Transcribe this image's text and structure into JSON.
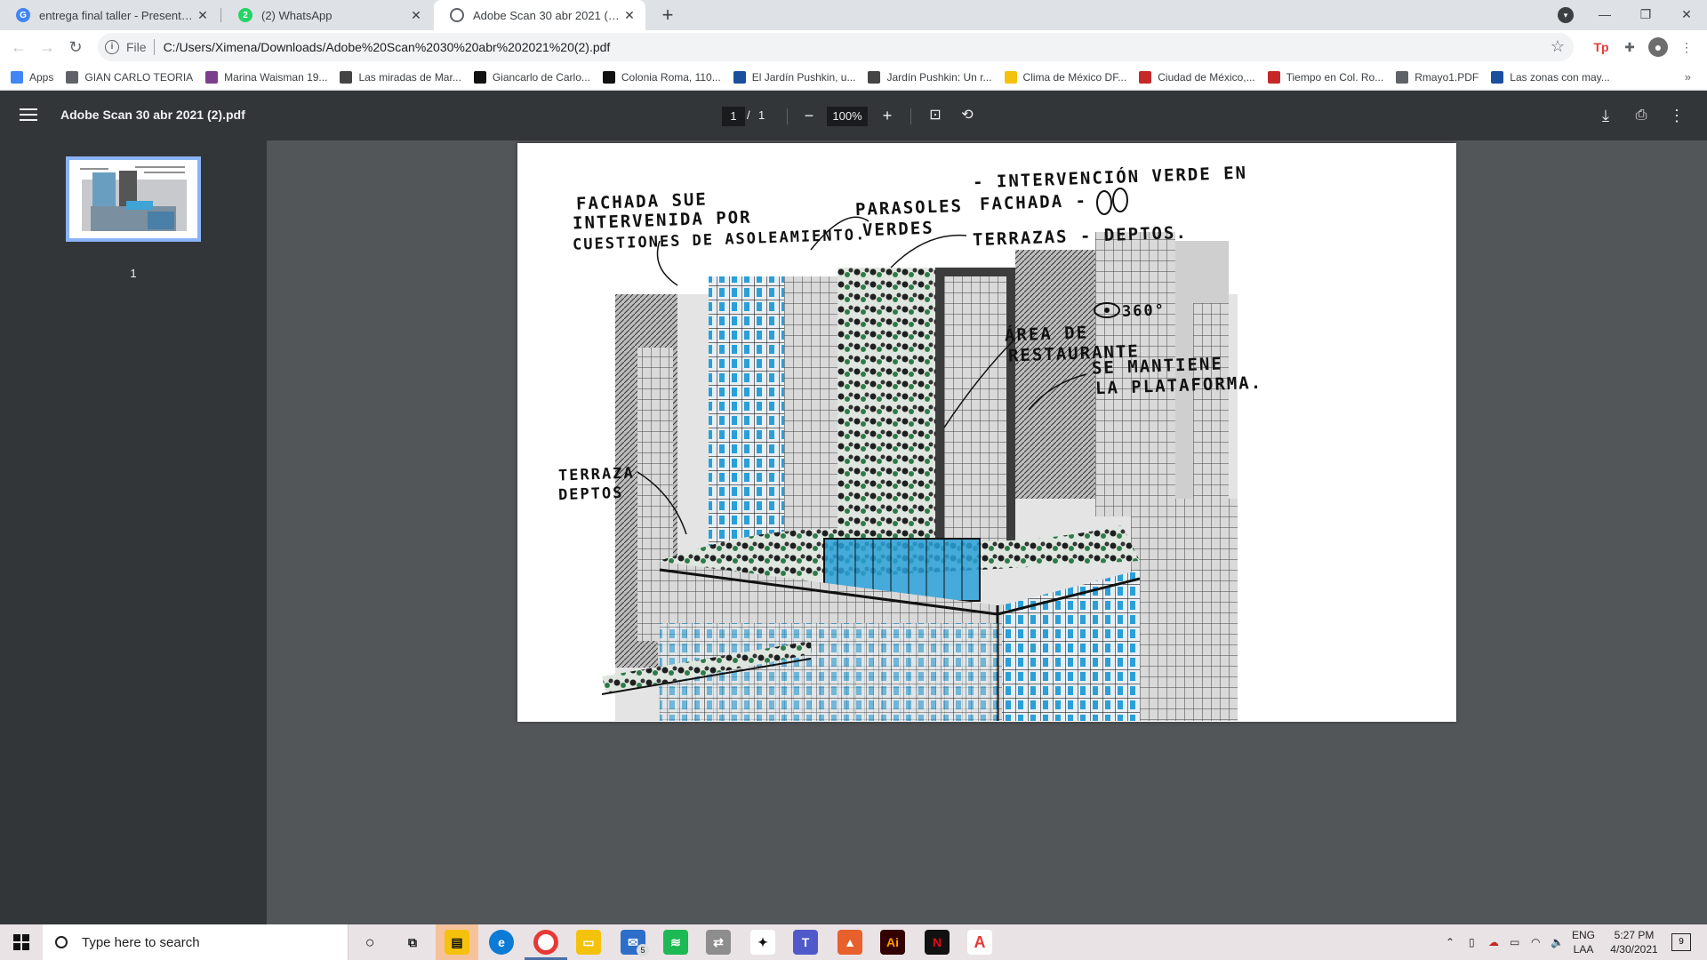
{
  "browser": {
    "tabs": [
      {
        "title": "entrega final taller - Presentación",
        "favicon": "google-slides-icon",
        "active": false
      },
      {
        "title": "(2) WhatsApp",
        "favicon": "whatsapp-icon",
        "badge": "2",
        "active": false
      },
      {
        "title": "Adobe Scan 30 abr 2021 (2).pdf",
        "favicon": "globe-icon",
        "active": true
      }
    ],
    "new_tab_label": "+",
    "address": {
      "scheme": "File",
      "url": "C:/Users/Ximena/Downloads/Adobe%20Scan%2030%20abr%202021%20(2).pdf"
    },
    "bookmarks": [
      {
        "label": "Apps",
        "icon": "apps-grid-icon",
        "color": "#4285f4"
      },
      {
        "label": "GIAN CARLO TEORIA",
        "icon": "globe-icon",
        "color": "#5f6368"
      },
      {
        "label": "Marina Waisman 19...",
        "icon": "book-icon",
        "color": "#7b3f8c"
      },
      {
        "label": "Las miradas de Mar...",
        "icon": "feather-icon",
        "color": "#444444"
      },
      {
        "label": "Giancarlo de Carlo...",
        "icon": "u-icon",
        "color": "#111111"
      },
      {
        "label": "Colonia Roma, 110...",
        "icon": "circle-icon",
        "color": "#111111"
      },
      {
        "label": "El Jardín Pushkin, u...",
        "icon": "news-icon",
        "color": "#1a4f9c"
      },
      {
        "label": "Jardín Pushkin: Un r...",
        "icon": "link-icon",
        "color": "#444444"
      },
      {
        "label": "Clima de México DF...",
        "icon": "sun-icon",
        "color": "#f4c20d"
      },
      {
        "label": "Ciudad de México,...",
        "icon": "news-icon",
        "color": "#c62828"
      },
      {
        "label": "Tiempo en Col. Ro...",
        "icon": "weather-icon",
        "color": "#c62828"
      },
      {
        "label": "Rmayo1.PDF",
        "icon": "globe-icon",
        "color": "#5f6368"
      },
      {
        "label": "Las zonas con may...",
        "icon": "d-icon",
        "color": "#1a4f9c"
      }
    ]
  },
  "pdf": {
    "title": "Adobe Scan 30 abr 2021 (2).pdf",
    "current_page": "1",
    "page_separator": "/",
    "total_pages": "1",
    "zoom": "100%",
    "thumbnail_page_number": "1"
  },
  "sketch": {
    "labels": {
      "fachada_1": "FACHADA SUE",
      "fachada_2": "INTERVENIDA POR",
      "fachada_3": "CUESTIONES DE ASOLEAMIENTO.",
      "parasoles_1": "PARASOLES",
      "parasoles_2": "VERDES",
      "interv_1": "- INTERVENCIÓN VERDE EN",
      "interv_2": "FACHADA -",
      "terrazas": "TERRAZAS - DEPTOS.",
      "vista": "360°",
      "area_1": "ÁREA DE",
      "area_2": "RESTAURANTE",
      "plat_1": "SE MANTIENE",
      "plat_2": "LA PLATAFORMA.",
      "terr_left_1": "TERRAZA",
      "terr_left_2": "DEPTOS"
    }
  },
  "taskbar": {
    "search_placeholder": "Type here to search",
    "language": "ENG",
    "layout": "LAA",
    "time": "5:27 PM",
    "date": "4/30/2021",
    "notification_count": "9",
    "mail_badge": "5"
  },
  "colors": {
    "pdf_toolbar": "#323639",
    "pdf_background": "#525659",
    "thumbnail_border": "#8ab4f8",
    "tab_strip": "#dee1e6"
  }
}
